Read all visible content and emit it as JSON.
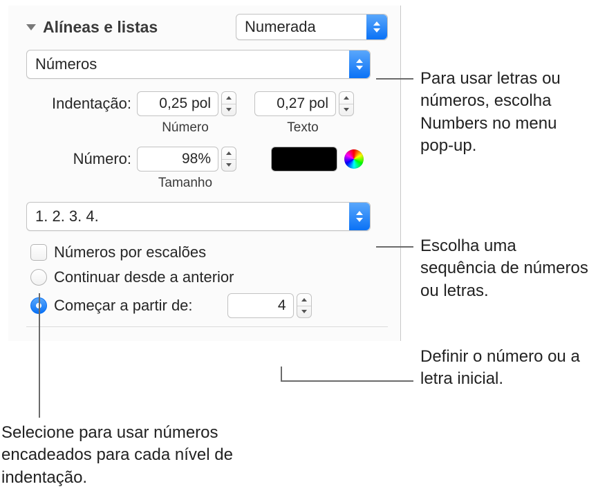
{
  "section": {
    "title": "Alíneas e listas",
    "listTypeValue": "Numerada"
  },
  "numberFormatPopup": "Números",
  "indent": {
    "label": "Indentação:",
    "numberValue": "0,25 pol",
    "numberSublabel": "Número",
    "textValue": "0,27 pol",
    "textSublabel": "Texto"
  },
  "number": {
    "label": "Número:",
    "sizeValue": "98%",
    "sizeSublabel": "Tamanho"
  },
  "sequencePopup": "1. 2. 3. 4.",
  "tieredCheckbox": "Números por escalões",
  "radios": {
    "continue": "Continuar desde a anterior",
    "startFrom": "Começar a partir de:",
    "startValue": "4"
  },
  "annotations": {
    "topRight": "Para usar letras ou números, escolha Numbers no menu pop-up.",
    "sequence": "Escolha uma sequência de números ou letras.",
    "startNumber": "Definir o número ou a letra inicial.",
    "tiered": "Selecione para usar números encadeados para cada nível de indentação."
  }
}
